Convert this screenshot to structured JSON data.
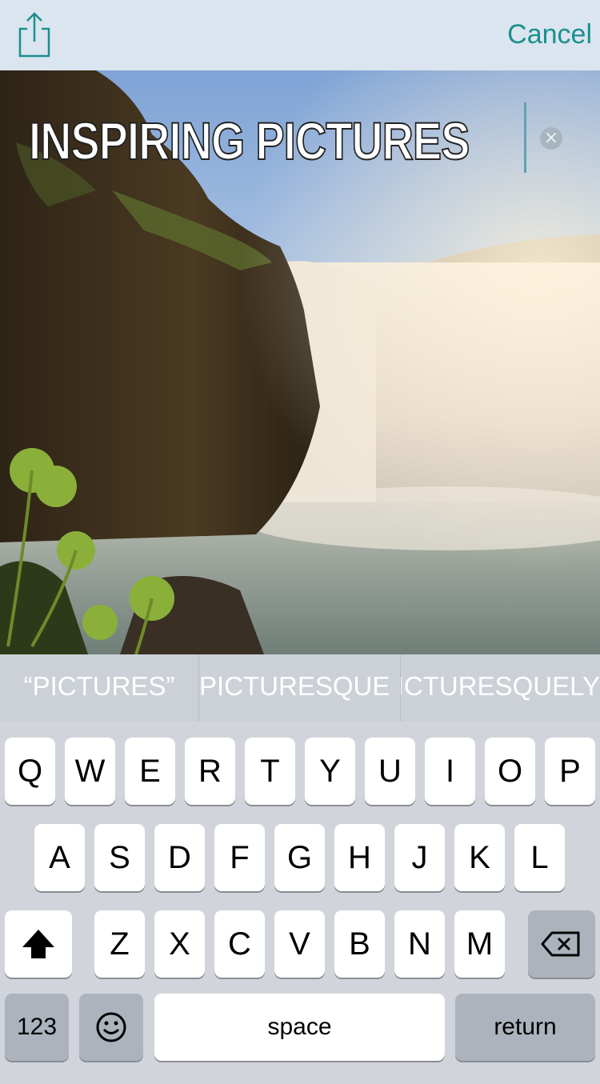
{
  "toolbar": {
    "share_icon": "share-icon",
    "cancel_label": "Cancel",
    "accent_color": "#1a8f8f"
  },
  "photo": {
    "caption_text": "INSPIRING PICTURES",
    "clear_icon": "clear-text-icon"
  },
  "suggestions": [
    "“PICTURES”",
    "PICTURESQUE",
    "PICTURESQUELY"
  ],
  "keyboard": {
    "row1": [
      "Q",
      "W",
      "E",
      "R",
      "T",
      "Y",
      "U",
      "I",
      "O",
      "P"
    ],
    "row2": [
      "A",
      "S",
      "D",
      "F",
      "G",
      "H",
      "J",
      "K",
      "L"
    ],
    "row3": [
      "Z",
      "X",
      "C",
      "V",
      "B",
      "N",
      "M"
    ],
    "shift_icon": "shift-arrow-icon",
    "delete_icon": "backspace-icon",
    "numbers_label": "123",
    "emoji_icon": "emoji-icon",
    "space_label": "space",
    "return_label": "return"
  }
}
